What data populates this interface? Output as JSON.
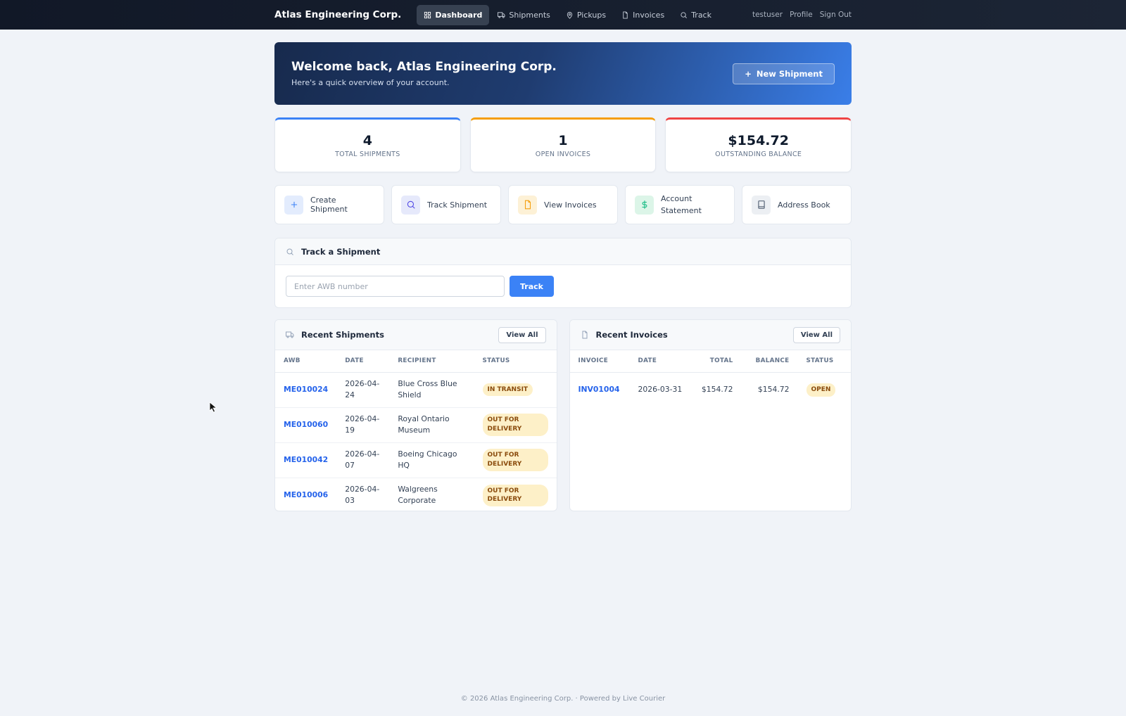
{
  "nav": {
    "brand": "Atlas Engineering Corp.",
    "items": [
      {
        "label": "Dashboard",
        "icon": "grid-icon",
        "active": true
      },
      {
        "label": "Shipments",
        "icon": "truck-icon"
      },
      {
        "label": "Pickups",
        "icon": "map-pin-icon"
      },
      {
        "label": "Invoices",
        "icon": "file-icon"
      },
      {
        "label": "Track",
        "icon": "search-icon"
      }
    ],
    "user": "testuser",
    "profile": "Profile",
    "sign_out": "Sign Out"
  },
  "hero": {
    "title": "Welcome back, Atlas Engineering Corp.",
    "subtitle": "Here's a quick overview of your account.",
    "button": "New Shipment"
  },
  "stats": [
    {
      "value": "4",
      "label": "TOTAL SHIPMENTS",
      "color": "#3b82f6"
    },
    {
      "value": "1",
      "label": "OPEN INVOICES",
      "color": "#f59e0b"
    },
    {
      "value": "$154.72",
      "label": "OUTSTANDING BALANCE",
      "color": "#ef4444"
    }
  ],
  "quick_actions": [
    {
      "label": "Create Shipment",
      "icon": "plus-icon"
    },
    {
      "label": "Track Shipment",
      "icon": "search-icon"
    },
    {
      "label": "View Invoices",
      "icon": "file-icon"
    },
    {
      "label": "Account Statement",
      "icon": "dollar-icon"
    },
    {
      "label": "Address Book",
      "icon": "book-icon"
    }
  ],
  "track": {
    "title": "Track a Shipment",
    "placeholder": "Enter AWB number",
    "button": "Track"
  },
  "recent_shipments": {
    "title": "Recent Shipments",
    "view_all": "View All",
    "columns": [
      "AWB",
      "DATE",
      "RECIPIENT",
      "STATUS"
    ],
    "rows": [
      {
        "awb": "ME010024",
        "date": "2026-04-24",
        "recipient": "Blue Cross Blue Shield",
        "status": "IN TRANSIT"
      },
      {
        "awb": "ME010060",
        "date": "2026-04-19",
        "recipient": "Royal Ontario Museum",
        "status": "OUT FOR DELIVERY"
      },
      {
        "awb": "ME010042",
        "date": "2026-04-07",
        "recipient": "Boeing Chicago HQ",
        "status": "OUT FOR DELIVERY"
      },
      {
        "awb": "ME010006",
        "date": "2026-04-03",
        "recipient": "Walgreens Corporate",
        "status": "OUT FOR DELIVERY"
      }
    ]
  },
  "recent_invoices": {
    "title": "Recent Invoices",
    "view_all": "View All",
    "columns": [
      "INVOICE",
      "DATE",
      "TOTAL",
      "BALANCE",
      "STATUS"
    ],
    "rows": [
      {
        "invoice": "INV01004",
        "date": "2026-03-31",
        "total": "$154.72",
        "balance": "$154.72",
        "status": "OPEN"
      }
    ]
  },
  "footer": "© 2026 Atlas Engineering Corp. · Powered by Live Courier"
}
